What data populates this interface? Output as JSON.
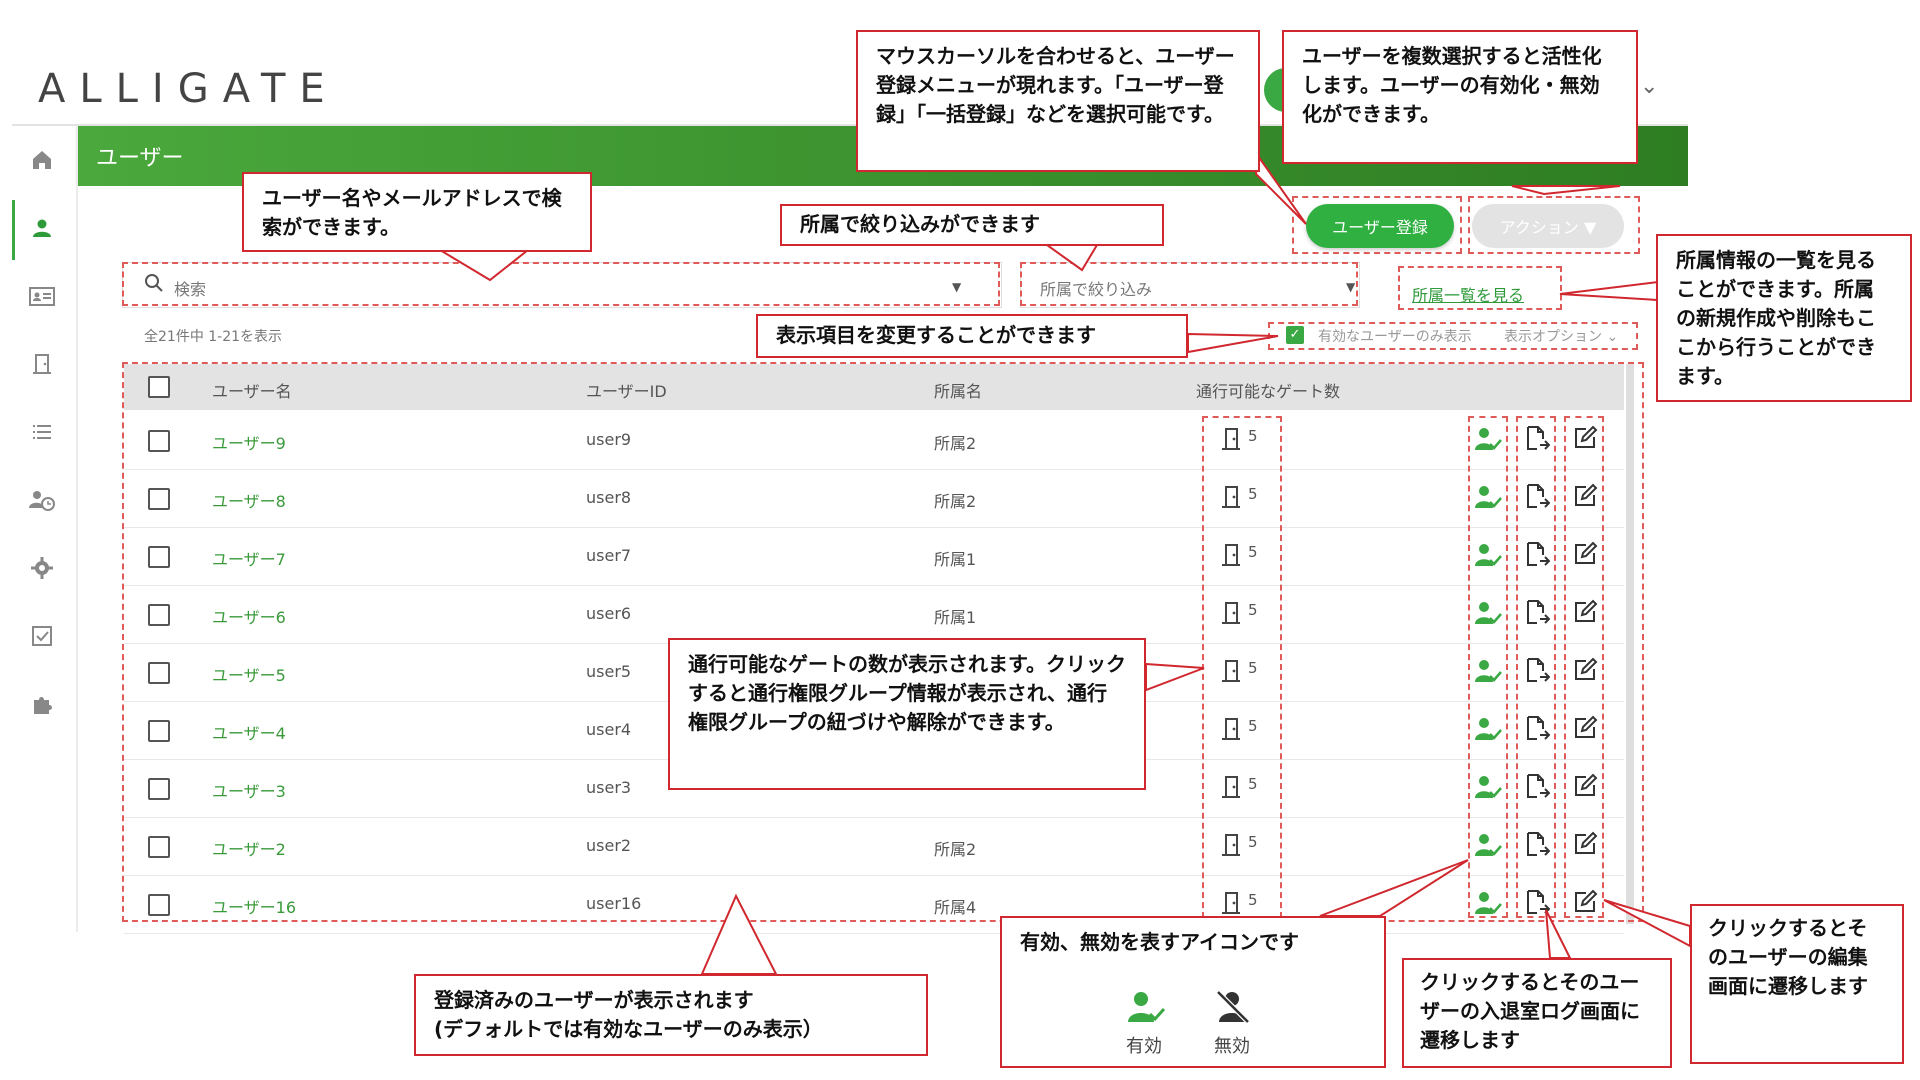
{
  "app": {
    "logo": "ALLIGATE",
    "page_title": "ユーザー"
  },
  "sidebar": {
    "icons": [
      "home-icon",
      "user-icon",
      "id-card-icon",
      "door-icon",
      "list-icon",
      "user-clock-icon",
      "gear-icon",
      "checkbox-icon",
      "puzzle-icon"
    ],
    "active": "user-icon"
  },
  "toolbar": {
    "search_placeholder": "検索",
    "filter_placeholder": "所属で絞り込み",
    "affiliation_list_link": "所属一覧を見る",
    "register_button": "ユーザー登録",
    "action_button": "アクション ▼",
    "count_text": "全21件中 1-21を表示",
    "active_only_label": "有効なユーザーのみ表示",
    "display_options": "表示オプション ⌄"
  },
  "table": {
    "headers": {
      "name": "ユーザー名",
      "id": "ユーザーID",
      "affiliation": "所属名",
      "gates": "通行可能なゲート数"
    },
    "rows": [
      {
        "name": "ユーザー9",
        "id": "user9",
        "affiliation": "所属2",
        "gates": "5"
      },
      {
        "name": "ユーザー8",
        "id": "user8",
        "affiliation": "所属2",
        "gates": "5"
      },
      {
        "name": "ユーザー7",
        "id": "user7",
        "affiliation": "所属1",
        "gates": "5"
      },
      {
        "name": "ユーザー6",
        "id": "user6",
        "affiliation": "所属1",
        "gates": "5"
      },
      {
        "name": "ユーザー5",
        "id": "user5",
        "affiliation": "",
        "gates": "5"
      },
      {
        "name": "ユーザー4",
        "id": "user4",
        "affiliation": "",
        "gates": "5"
      },
      {
        "name": "ユーザー3",
        "id": "user3",
        "affiliation": "",
        "gates": "5"
      },
      {
        "name": "ユーザー2",
        "id": "user2",
        "affiliation": "所属2",
        "gates": "5"
      },
      {
        "name": "ユーザー16",
        "id": "user16",
        "affiliation": "所属4",
        "gates": "5"
      }
    ]
  },
  "annotations": {
    "search": "ユーザー名やメールアドレスで検索ができます。",
    "register": "マウスカーソルを合わせると、ユーザー登録メニューが現れます。「ユーザー登録」「一括登録」などを選択可能です。",
    "action": "ユーザーを複数選択すると活性化します。ユーザーの有効化・無効化ができます。",
    "filter": "所属で絞り込みができます",
    "affiliation_list": "所属情報の一覧を見ることができます。所属の新規作成や削除もここから行うことができます。",
    "display_items": "表示項目を変更することができます",
    "gates": "通行可能なゲートの数が表示されます。クリックすると通行権限グループ情報が表示され、通行権限グループの紐づけや解除ができます。",
    "users_list_line1": "登録済みのユーザーが表示されます",
    "users_list_line2": "(デフォルトでは有効なユーザーのみ表示）",
    "status_icon": "有効、無効を表すアイコンです",
    "status_active": "有効",
    "status_inactive": "無効",
    "log": "クリックするとそのユーザーの入退室ログ画面に遷移します",
    "edit": "クリックするとそのユーザーの編集画面に遷移します"
  },
  "colors": {
    "accent": "#3aa843",
    "annotation": "#d0282e"
  }
}
